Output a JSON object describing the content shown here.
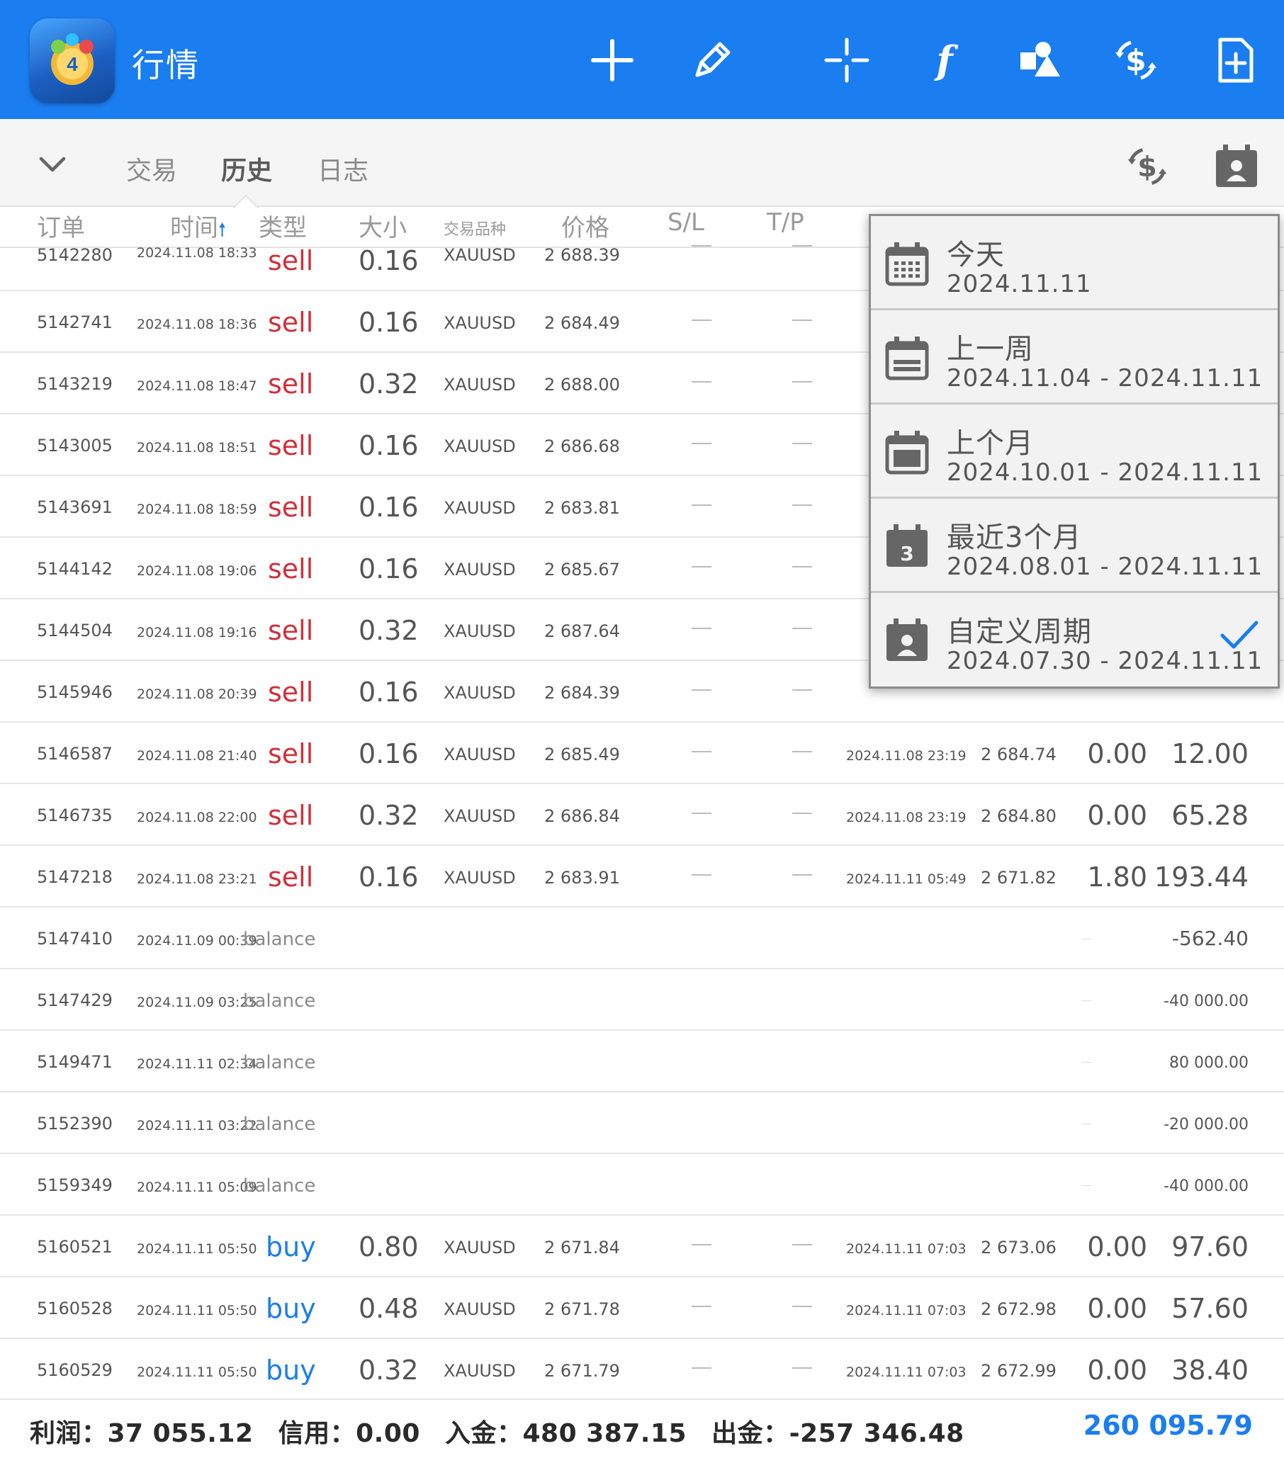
{
  "topbar": {
    "title": "行情",
    "icons": [
      "plus-icon",
      "pencil-icon",
      "crosshair-icon",
      "function-icon",
      "objects-icon",
      "dollar-sync-icon",
      "new-document-icon"
    ],
    "color": "#1a7df0"
  },
  "subbar": {
    "tabs": [
      {
        "label": "交易"
      },
      {
        "label": "历史"
      },
      {
        "label": "日志"
      }
    ],
    "active_tab": "历史"
  },
  "table": {
    "headers": {
      "order": "订单",
      "time": "时间",
      "type": "类型",
      "size": "大小",
      "symbol": "交易品种",
      "price": "价格",
      "sl": "S/L",
      "tp": "T/P"
    },
    "rows": [
      {
        "order": "5142280",
        "time": "2024.11.08 18:33",
        "type": "sell",
        "size": "0.16",
        "symbol": "XAUUSD",
        "price": "2 688.39",
        "close_time": "",
        "close_price": "",
        "swap": "",
        "profit": ""
      },
      {
        "order": "5142741",
        "time": "2024.11.08 18:36",
        "type": "sell",
        "size": "0.16",
        "symbol": "XAUUSD",
        "price": "2 684.49",
        "close_time": "",
        "close_price": "",
        "swap": "",
        "profit": ""
      },
      {
        "order": "5143219",
        "time": "2024.11.08 18:47",
        "type": "sell",
        "size": "0.32",
        "symbol": "XAUUSD",
        "price": "2 688.00",
        "close_time": "",
        "close_price": "",
        "swap": "",
        "profit": ""
      },
      {
        "order": "5143005",
        "time": "2024.11.08 18:51",
        "type": "sell",
        "size": "0.16",
        "symbol": "XAUUSD",
        "price": "2 686.68",
        "close_time": "",
        "close_price": "",
        "swap": "",
        "profit": ""
      },
      {
        "order": "5143691",
        "time": "2024.11.08 18:59",
        "type": "sell",
        "size": "0.16",
        "symbol": "XAUUSD",
        "price": "2 683.81",
        "close_time": "",
        "close_price": "",
        "swap": "",
        "profit": ""
      },
      {
        "order": "5144142",
        "time": "2024.11.08 19:06",
        "type": "sell",
        "size": "0.16",
        "symbol": "XAUUSD",
        "price": "2 685.67",
        "close_time": "",
        "close_price": "",
        "swap": "",
        "profit": ""
      },
      {
        "order": "5144504",
        "time": "2024.11.08 19:16",
        "type": "sell",
        "size": "0.32",
        "symbol": "XAUUSD",
        "price": "2 687.64",
        "close_time": "",
        "close_price": "",
        "swap": "",
        "profit": ""
      },
      {
        "order": "5145946",
        "time": "2024.11.08 20:39",
        "type": "sell",
        "size": "0.16",
        "symbol": "XAUUSD",
        "price": "2 684.39",
        "close_time": "",
        "close_price": "",
        "swap": "",
        "profit": ""
      },
      {
        "order": "5146587",
        "time": "2024.11.08 21:40",
        "type": "sell",
        "size": "0.16",
        "symbol": "XAUUSD",
        "price": "2 685.49",
        "close_time": "2024.11.08 23:19",
        "close_price": "2 684.74",
        "swap": "0.00",
        "profit": "12.00"
      },
      {
        "order": "5146735",
        "time": "2024.11.08 22:00",
        "type": "sell",
        "size": "0.32",
        "symbol": "XAUUSD",
        "price": "2 686.84",
        "close_time": "2024.11.08 23:19",
        "close_price": "2 684.80",
        "swap": "0.00",
        "profit": "65.28"
      },
      {
        "order": "5147218",
        "time": "2024.11.08 23:21",
        "type": "sell",
        "size": "0.16",
        "symbol": "XAUUSD",
        "price": "2 683.91",
        "close_time": "2024.11.11 05:49",
        "close_price": "2 671.82",
        "swap": "1.80",
        "profit": "193.44"
      },
      {
        "order": "5147410",
        "time": "2024.11.09 00:39",
        "type": "balance",
        "size": "",
        "symbol": "",
        "price": "",
        "close_time": "",
        "close_price": "",
        "swap": "",
        "profit": "-562.40"
      },
      {
        "order": "5147429",
        "time": "2024.11.09 03:25",
        "type": "balance",
        "size": "",
        "symbol": "",
        "price": "",
        "close_time": "",
        "close_price": "",
        "swap": "",
        "profit": "-40 000.00"
      },
      {
        "order": "5149471",
        "time": "2024.11.11 02:34",
        "type": "balance",
        "size": "",
        "symbol": "",
        "price": "",
        "close_time": "",
        "close_price": "",
        "swap": "",
        "profit": "80 000.00"
      },
      {
        "order": "5152390",
        "time": "2024.11.11 03:22",
        "type": "balance",
        "size": "",
        "symbol": "",
        "price": "",
        "close_time": "",
        "close_price": "",
        "swap": "",
        "profit": "-20 000.00"
      },
      {
        "order": "5159349",
        "time": "2024.11.11 05:09",
        "type": "balance",
        "size": "",
        "symbol": "",
        "price": "",
        "close_time": "",
        "close_price": "",
        "swap": "",
        "profit": "-40 000.00"
      },
      {
        "order": "5160521",
        "time": "2024.11.11 05:50",
        "type": "buy",
        "size": "0.80",
        "symbol": "XAUUSD",
        "price": "2 671.84",
        "close_time": "2024.11.11 07:03",
        "close_price": "2 673.06",
        "swap": "0.00",
        "profit": "97.60"
      },
      {
        "order": "5160528",
        "time": "2024.11.11 05:50",
        "type": "buy",
        "size": "0.48",
        "symbol": "XAUUSD",
        "price": "2 671.78",
        "close_time": "2024.11.11 07:03",
        "close_price": "2 672.98",
        "swap": "0.00",
        "profit": "57.60"
      },
      {
        "order": "5160529",
        "time": "2024.11.11 05:50",
        "type": "buy",
        "size": "0.32",
        "symbol": "XAUUSD",
        "price": "2 671.79",
        "close_time": "2024.11.11 07:03",
        "close_price": "2 672.99",
        "swap": "0.00",
        "profit": "38.40"
      }
    ]
  },
  "dropdown": {
    "items": [
      {
        "label": "今天",
        "range": "2024.11.11",
        "icon": "calendar-day-icon",
        "checked": false
      },
      {
        "label": "上一周",
        "range": "2024.11.04 - 2024.11.11",
        "icon": "calendar-week-icon",
        "checked": false
      },
      {
        "label": "上个月",
        "range": "2024.10.01 - 2024.11.11",
        "icon": "calendar-month-icon",
        "checked": false
      },
      {
        "label": "最近3个月",
        "range": "2024.08.01 - 2024.11.11",
        "icon": "calendar-3-months-icon",
        "icon_text": "3",
        "checked": false
      },
      {
        "label": "自定义周期",
        "range": "2024.07.30 - 2024.11.11",
        "icon": "calendar-custom-icon",
        "checked": true
      }
    ]
  },
  "footer": {
    "profit": "利润：37 055.12",
    "credit": "信用：0.00",
    "deposit": "入金：480 387.15",
    "withdrawal": "出金：-257 346.48",
    "total": "260 095.79"
  }
}
